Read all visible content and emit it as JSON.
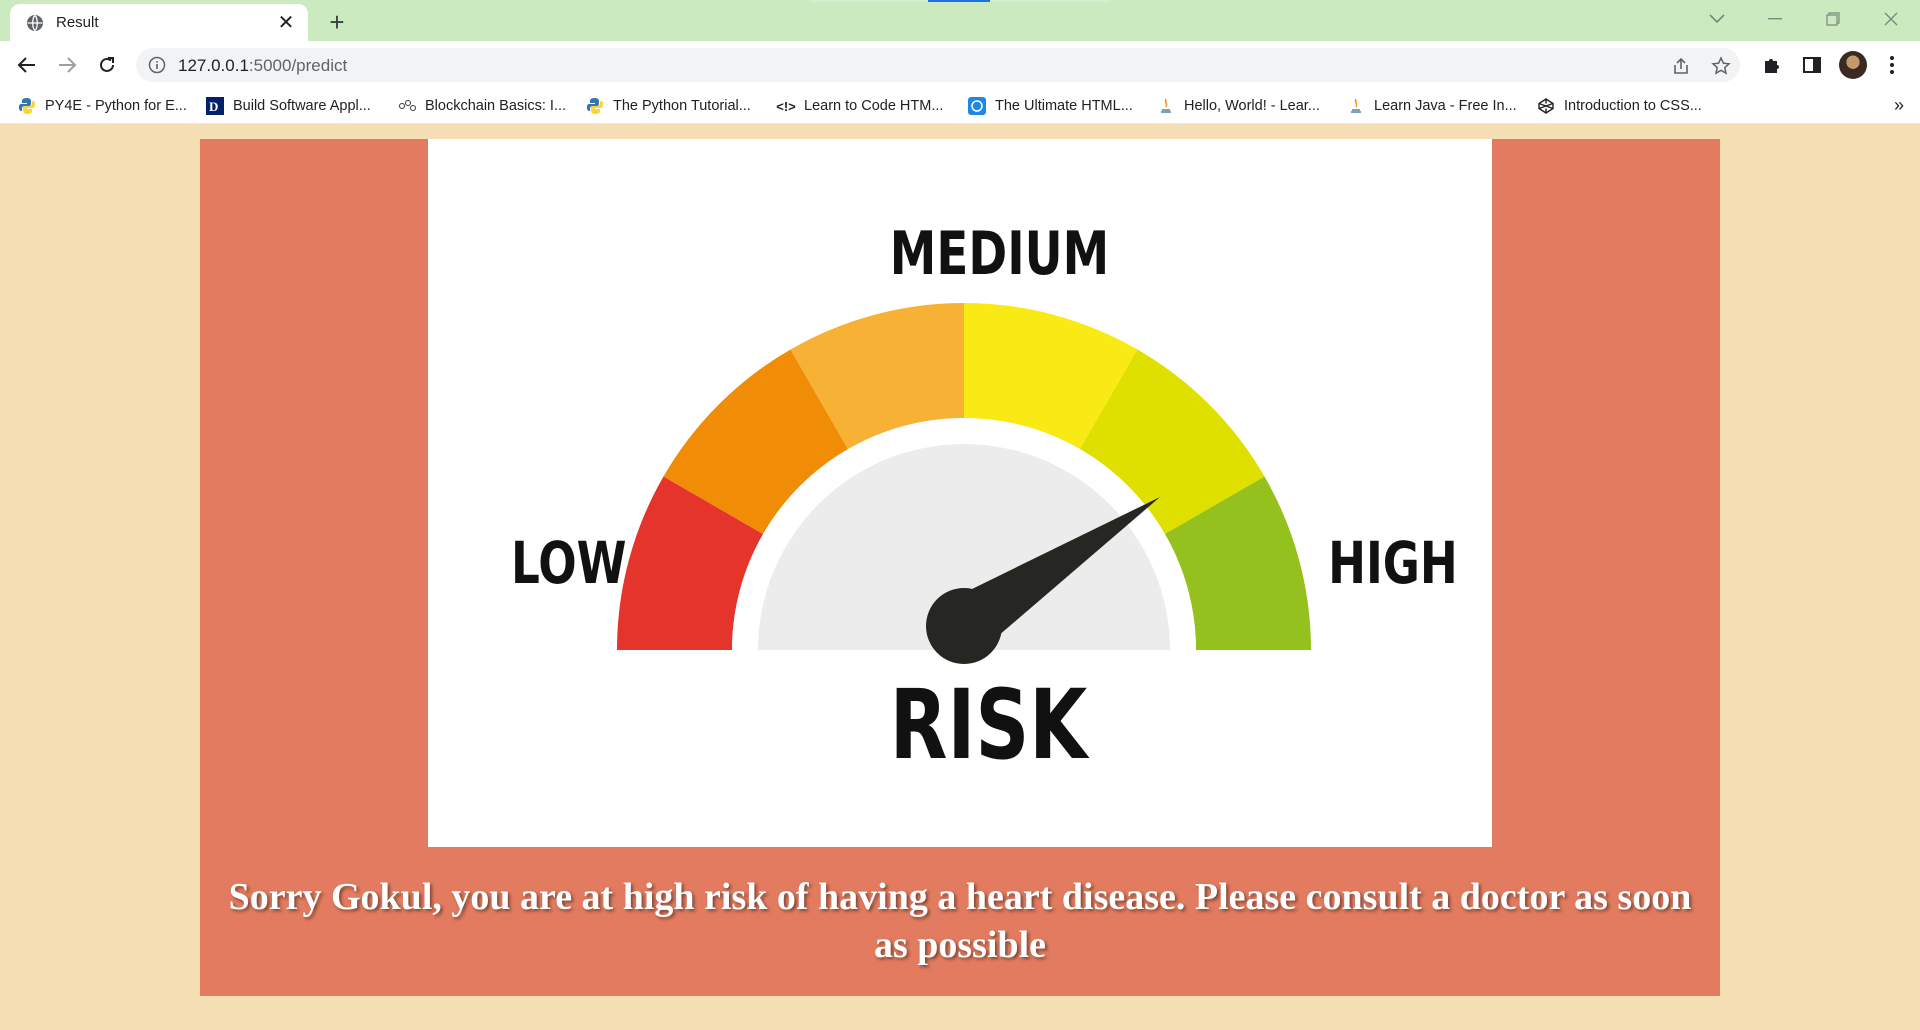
{
  "browser": {
    "tab_title": "Result",
    "url_host": "127.0.0.1",
    "url_path": ":5000/predict",
    "bookmarks": [
      {
        "label": "PY4E - Python for E...",
        "icon": "python-icon"
      },
      {
        "label": "Build Software Appl...",
        "icon": "duke-icon"
      },
      {
        "label": "Blockchain Basics: I...",
        "icon": "blockchain-icon"
      },
      {
        "label": "The Python Tutorial...",
        "icon": "python-icon"
      },
      {
        "label": "Learn to Code HTM...",
        "icon": "code-brackets-icon"
      },
      {
        "label": "The Ultimate HTML...",
        "icon": "html-icon"
      },
      {
        "label": "Hello, World! - Lear...",
        "icon": "java-icon"
      },
      {
        "label": "Learn Java - Free In...",
        "icon": "java-icon"
      },
      {
        "label": "Introduction to CSS...",
        "icon": "codepen-icon"
      }
    ],
    "bookmarks_overflow": "»"
  },
  "gauge": {
    "label_medium": "MEDIUM",
    "label_low": "LOW",
    "label_high": "HIGH",
    "label_risk": "RISK",
    "segment_colors": [
      "#e5342b",
      "#f08c05",
      "#f7b235",
      "#f9e915",
      "#dfdf00",
      "#95c11f"
    ],
    "needle_color": "#262622"
  },
  "result": {
    "message": "Sorry Gokul, you are at high risk of having a heart disease. Please consult a doctor as soon as possible"
  }
}
